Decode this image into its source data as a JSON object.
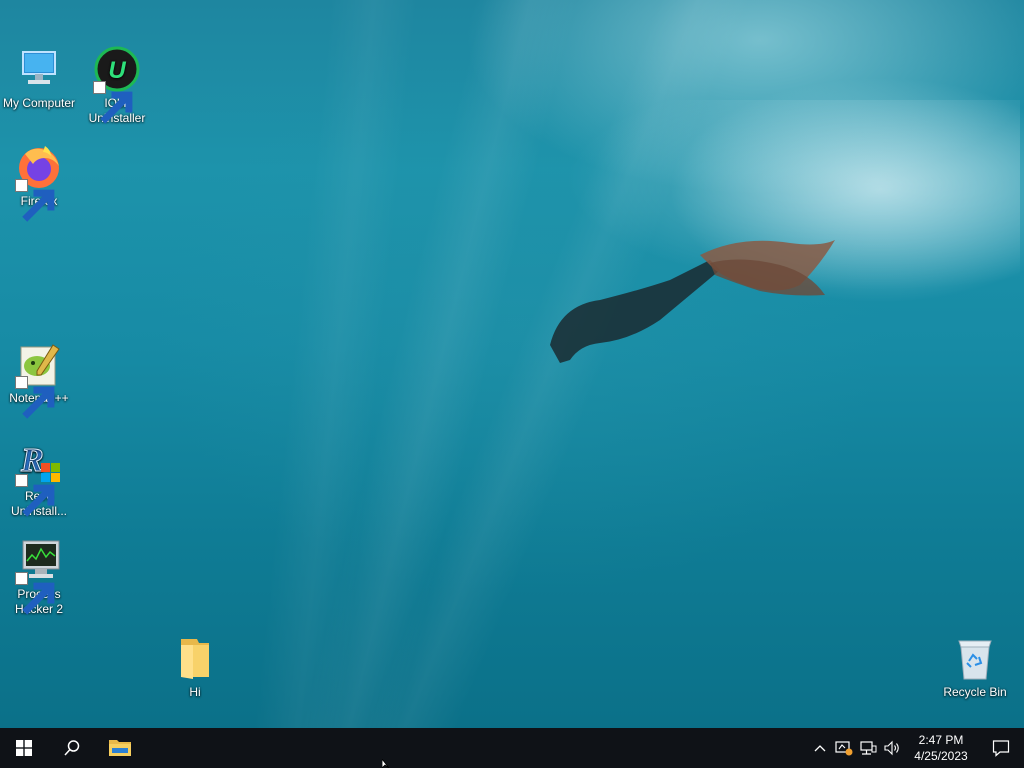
{
  "desktop": {
    "icons": [
      {
        "label": "My Computer",
        "icon": "my-computer-icon"
      },
      {
        "label": "IObit Uninstaller",
        "icon": "iobit-uninstaller-icon",
        "shortcut": true
      },
      {
        "label": "Firefox",
        "icon": "firefox-icon",
        "shortcut": true
      },
      {
        "label": "Notepad++",
        "icon": "notepad-plus-plus-icon",
        "shortcut": true
      },
      {
        "label": "Revo Uninstall...",
        "icon": "revo-uninstaller-icon",
        "shortcut": true
      },
      {
        "label": "Process Hacker 2",
        "icon": "process-hacker-icon",
        "shortcut": true
      },
      {
        "label": "Hi",
        "icon": "folder-icon"
      },
      {
        "label": "Recycle Bin",
        "icon": "recycle-bin-icon"
      }
    ]
  },
  "taskbar": {
    "start_icon": "windows-logo-icon",
    "search_icon": "search-icon",
    "pinned": [
      {
        "icon": "file-explorer-icon"
      }
    ],
    "tray": {
      "icons": [
        "chevron-up-icon",
        "security-center-icon",
        "network-icon",
        "volume-icon"
      ],
      "time": "2:47 PM",
      "date": "4/25/2023",
      "notification_icon": "action-center-icon"
    }
  },
  "colors": {
    "taskbar_bg": "#0f1217",
    "water_top": "#1e86a0",
    "water_bottom": "#0a6e86",
    "folder_yellow": "#f8d26a",
    "firefox_orange": "#ff7139",
    "firefox_purple": "#7542e5",
    "iobit_green": "#1db954"
  }
}
